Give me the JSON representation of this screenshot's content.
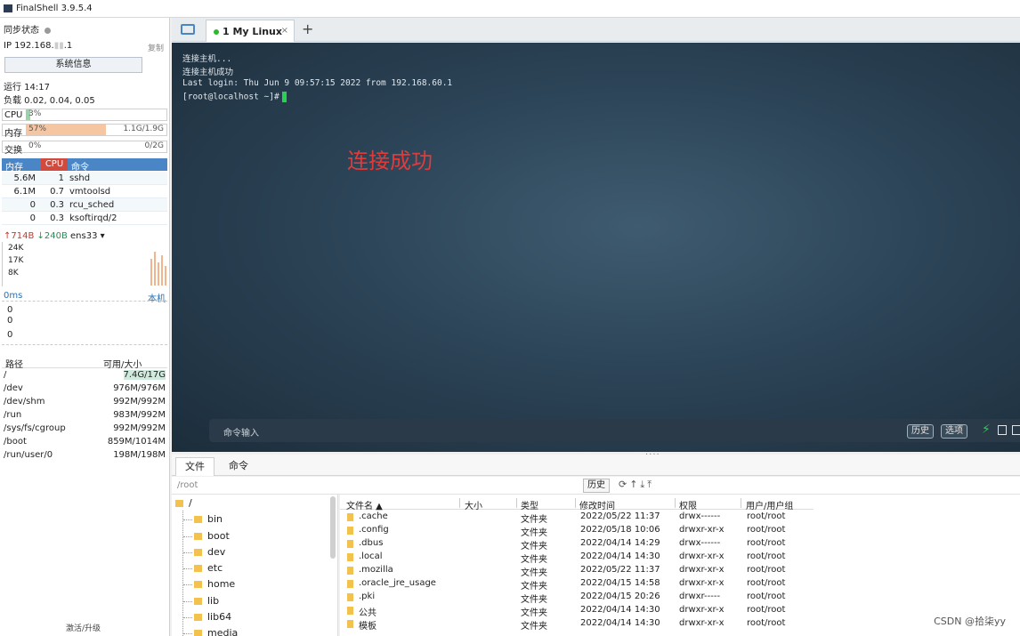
{
  "app": {
    "title": "FinalShell 3.9.5.4"
  },
  "left": {
    "sync_label": "同步状态",
    "ip_label": "IP 192.168.",
    "ip_tail": ".1",
    "copy": "复制",
    "sysinfo_button": "系统信息",
    "uptime": "运行 14:17",
    "load": "负载 0.02, 0.04, 0.05",
    "cpu": {
      "label": "CPU",
      "pct": "3%",
      "fill": 0.03
    },
    "mem": {
      "label": "内存",
      "pct": "57%",
      "right": "1.1G/1.9G",
      "fill": 0.57
    },
    "swap": {
      "label": "交换",
      "pct": "0%",
      "right": "0/2G",
      "fill": 0
    },
    "proc_head": {
      "mem": "内存",
      "cpu": "CPU",
      "cmd": "命令"
    },
    "procs": [
      {
        "mem": "5.6M",
        "cpu": "1",
        "cmd": "sshd"
      },
      {
        "mem": "6.1M",
        "cpu": "0.7",
        "cmd": "vmtoolsd"
      },
      {
        "mem": "0",
        "cpu": "0.3",
        "cmd": "rcu_sched"
      },
      {
        "mem": "0",
        "cpu": "0.3",
        "cmd": "ksoftirqd/2"
      }
    ],
    "net": {
      "up": "↑714B",
      "down": "↓240B",
      "iface": "ens33 ▾"
    },
    "net_scale": [
      "24K",
      "17K",
      "8K"
    ],
    "ping": {
      "left": "0ms",
      "right": "本机",
      "values": [
        "0",
        "0",
        "0"
      ]
    },
    "disk_head": {
      "path": "路径",
      "avail": "可用/大小"
    },
    "disks": [
      {
        "path": "/",
        "avail": "7.4G/17G"
      },
      {
        "path": "/dev",
        "avail": "976M/976M"
      },
      {
        "path": "/dev/shm",
        "avail": "992M/992M"
      },
      {
        "path": "/run",
        "avail": "983M/992M"
      },
      {
        "path": "/sys/fs/cgroup",
        "avail": "992M/992M"
      },
      {
        "path": "/boot",
        "avail": "859M/1014M"
      },
      {
        "path": "/run/user/0",
        "avail": "198M/198M"
      }
    ],
    "activate": "激活/升级"
  },
  "tabs": {
    "session": "1 My Linux",
    "close": "×",
    "add": "+"
  },
  "terminal": {
    "lines": [
      "连接主机...",
      "连接主机成功",
      "Last login: Thu Jun  9 09:57:15 2022 from 192.168.60.1",
      "[root@localhost ~]#"
    ],
    "annotation": "连接成功",
    "cmd_placeholder": "命令输入",
    "history_btn": "历史",
    "options_btn": "选项"
  },
  "bottom": {
    "tab_files": "文件",
    "tab_cmd": "命令",
    "path": "/root",
    "history": "历史",
    "tree_root": "/",
    "tree": [
      "bin",
      "boot",
      "dev",
      "etc",
      "home",
      "lib",
      "lib64",
      "media"
    ],
    "columns": {
      "name": "文件名 ▲",
      "size": "大小",
      "type": "类型",
      "mtime": "修改时间",
      "perm": "权限",
      "owner": "用户/用户组"
    },
    "files": [
      {
        "name": ".cache",
        "type": "文件夹",
        "mtime": "2022/05/22 11:37",
        "perm": "drwx------",
        "owner": "root/root"
      },
      {
        "name": ".config",
        "type": "文件夹",
        "mtime": "2022/05/18 10:06",
        "perm": "drwxr-xr-x",
        "owner": "root/root"
      },
      {
        "name": ".dbus",
        "type": "文件夹",
        "mtime": "2022/04/14 14:29",
        "perm": "drwx------",
        "owner": "root/root"
      },
      {
        "name": ".local",
        "type": "文件夹",
        "mtime": "2022/04/14 14:30",
        "perm": "drwxr-xr-x",
        "owner": "root/root"
      },
      {
        "name": ".mozilla",
        "type": "文件夹",
        "mtime": "2022/05/22 11:37",
        "perm": "drwxr-xr-x",
        "owner": "root/root"
      },
      {
        "name": ".oracle_jre_usage",
        "type": "文件夹",
        "mtime": "2022/04/15 14:58",
        "perm": "drwxr-xr-x",
        "owner": "root/root"
      },
      {
        "name": ".pki",
        "type": "文件夹",
        "mtime": "2022/04/15 20:26",
        "perm": "drwxr-----",
        "owner": "root/root"
      },
      {
        "name": "公共",
        "type": "文件夹",
        "mtime": "2022/04/14 14:30",
        "perm": "drwxr-xr-x",
        "owner": "root/root"
      },
      {
        "name": "模板",
        "type": "文件夹",
        "mtime": "2022/04/14 14:30",
        "perm": "drwxr-xr-x",
        "owner": "root/root"
      }
    ]
  },
  "watermark": "CSDN @拾柒yy"
}
